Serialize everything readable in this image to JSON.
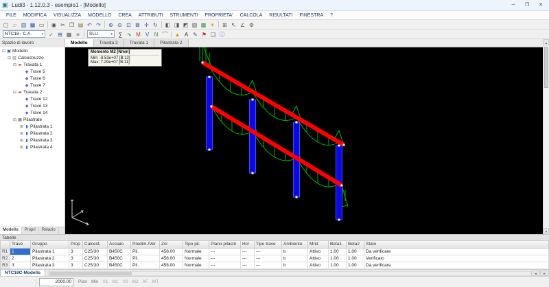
{
  "window": {
    "icon_glyph": "▣",
    "title": "Ludi3 - 1.12.0.3 - esempio1 - [Modello]",
    "minimize": "─",
    "maximize": "❐",
    "close": "✕"
  },
  "menu": {
    "items": [
      "FILE",
      "MODIFICA",
      "VISUALIZZA",
      "MODELLO",
      "CREA",
      "ATTRIBUTI",
      "STRUMENTI",
      "PROPRIETA'",
      "CALCOLA",
      "RISULTATI",
      "FINESTRA",
      "?"
    ]
  },
  "toolbar1": {
    "icons": [
      {
        "name": "new-file",
        "glyph": "▢",
        "style": "color:#444444"
      },
      {
        "name": "open-folder",
        "glyph": "▱",
        "style": "color:#c08a2d"
      },
      {
        "name": "save",
        "glyph": "▥",
        "style": "color:#2a5db0"
      },
      {
        "name": "save-all",
        "glyph": "▦",
        "style": "color:#2a5db0"
      },
      {
        "name": "print",
        "glyph": "▭",
        "style": "color:#444444"
      },
      {
        "name": "snapshot",
        "glyph": "◉",
        "style": "color:#444444"
      },
      {
        "name": "cut",
        "glyph": "✂",
        "style": "color:#444444"
      },
      {
        "name": "copy",
        "glyph": "❐",
        "style": "color:#444444"
      },
      {
        "name": "paste",
        "glyph": "▤",
        "style": "color:#8a6d3b"
      },
      {
        "name": "undo",
        "glyph": "↶",
        "style": "color:#2a5db0"
      },
      {
        "name": "redo",
        "glyph": "↷",
        "style": "color:#2a5db0"
      },
      {
        "name": "zoom-in",
        "glyph": "⊕",
        "style": "color:#2a5db0"
      },
      {
        "name": "zoom-out",
        "glyph": "⊖",
        "style": "color:#2a5db0"
      },
      {
        "name": "zoom-window",
        "glyph": "⊡",
        "style": "color:#2a5db0"
      },
      {
        "name": "zoom-extents",
        "glyph": "⊠",
        "style": "color:#2a5db0"
      },
      {
        "name": "pan",
        "glyph": "✛",
        "style": "color:#2a5db0"
      },
      {
        "name": "orbit",
        "glyph": "↻",
        "style": "color:#2a5db0"
      },
      {
        "name": "view-top",
        "glyph": "◧",
        "style": "color:#555555"
      },
      {
        "name": "view-front",
        "glyph": "◨",
        "style": "color:#555555"
      },
      {
        "name": "view-iso",
        "glyph": "◩",
        "style": "color:#555555"
      },
      {
        "name": "wireframe",
        "glyph": "▧",
        "style": "color:#555555"
      },
      {
        "name": "shaded",
        "glyph": "▩",
        "style": "color:#3e8e41"
      },
      {
        "name": "render",
        "glyph": "☀",
        "style": "color:#d49a00"
      },
      {
        "name": "grid",
        "glyph": "⊞",
        "style": "color:#555555"
      },
      {
        "name": "select-arrow",
        "glyph": "↖",
        "style": "color:#333333"
      },
      {
        "name": "measure",
        "glyph": "∠",
        "style": "color:#555555"
      },
      {
        "name": "options",
        "glyph": "⚙",
        "style": "color:#555555"
      }
    ]
  },
  "toolbar2": {
    "code": "NTC18 - C.A.",
    "slu": "SLU",
    "arrow": "▾",
    "icons_a": [
      {
        "name": "check-model",
        "glyph": "✓",
        "style": "color:#3e8e41"
      },
      {
        "name": "load-combinations",
        "glyph": "⊞",
        "style": "color:#2a5db0"
      },
      {
        "name": "tables",
        "glyph": "▦",
        "style": "color:#555555"
      },
      {
        "name": "properties-list",
        "glyph": "≡",
        "style": "color:#555555"
      }
    ],
    "icons_b": [
      {
        "name": "calculate",
        "glyph": "∑",
        "style": "color:#333333"
      },
      {
        "name": "diagram",
        "glyph": "∿",
        "style": "color:#00a000"
      },
      {
        "name": "moment-m",
        "glyph": "M",
        "style": "color:#c0392b"
      },
      {
        "name": "shear-v",
        "glyph": "V",
        "style": "color:#2a5db0"
      },
      {
        "name": "axial-n",
        "glyph": "N",
        "style": "color:#3e8e41"
      },
      {
        "name": "deformed-shape",
        "glyph": "⌒",
        "style": "color:#8e44ad"
      },
      {
        "name": "envelope",
        "glyph": "▲",
        "style": "color:#d49a00"
      },
      {
        "name": "labels",
        "glyph": "A",
        "style": "color:#333333"
      },
      {
        "name": "edit",
        "glyph": "✎",
        "style": "color:#555555"
      },
      {
        "name": "flag",
        "glyph": "⚑",
        "style": "color:#c0392b"
      },
      {
        "name": "layers",
        "glyph": "❏",
        "style": "color:#555555"
      },
      {
        "name": "info",
        "glyph": "ⓘ",
        "style": "color:#2a5db0"
      }
    ]
  },
  "workspace": {
    "title": "Spazio di lavoro",
    "tabs": [
      "Modello",
      "Propri",
      "Relazio"
    ],
    "tree": [
      {
        "label": "Modello",
        "expander": "⊟",
        "glyph": "▣",
        "iconstyle": "color:#2a5db0"
      },
      {
        "label": "Calcestruzzo",
        "expander": "⊟",
        "glyph": "▧",
        "iconstyle": "color:#777777"
      },
      {
        "label": "Travata 1",
        "expander": "⊟",
        "glyph": "▰",
        "iconstyle": "color:#c0392b"
      },
      {
        "label": "Trave 5",
        "expander": "",
        "glyph": "◆",
        "iconstyle": "color:#6a5acd"
      },
      {
        "label": "Trave 6",
        "expander": "",
        "glyph": "◆",
        "iconstyle": "color:#6a5acd"
      },
      {
        "label": "Trave 7",
        "expander": "",
        "glyph": "◆",
        "iconstyle": "color:#6a5acd"
      },
      {
        "label": "Travata 2",
        "expander": "⊟",
        "glyph": "▰",
        "iconstyle": "color:#c0392b"
      },
      {
        "label": "Trave 12",
        "expander": "",
        "glyph": "◆",
        "iconstyle": "color:#6a5acd"
      },
      {
        "label": "Trave 13",
        "expander": "",
        "glyph": "◆",
        "iconstyle": "color:#6a5acd"
      },
      {
        "label": "Trave 14",
        "expander": "",
        "glyph": "◆",
        "iconstyle": "color:#6a5acd"
      },
      {
        "label": "Pilastrate",
        "expander": "⊟",
        "glyph": "▦",
        "iconstyle": "color:#555555"
      },
      {
        "label": "Pilastrata 1",
        "expander": "⊞",
        "glyph": "▮",
        "iconstyle": "color:#2a6fd4"
      },
      {
        "label": "Pilastrata 2",
        "expander": "⊞",
        "glyph": "▮",
        "iconstyle": "color:#2a6fd4"
      },
      {
        "label": "Pilastrata 3",
        "expander": "⊞",
        "glyph": "▮",
        "iconstyle": "color:#2a6fd4"
      },
      {
        "label": "Pilastrata 4",
        "expander": "⊞",
        "glyph": "▮",
        "iconstyle": "color:#2a6fd4"
      }
    ]
  },
  "view": {
    "tabs": [
      "Modello",
      "Travata 2",
      "Travata 1",
      "Pilastrata 2"
    ],
    "tooltip": {
      "title": "Momento M2 [Nmm]",
      "min": "Min:   -8.53e+07 [B:12]",
      "max": "Max:   7.29e+07 [B:11]"
    }
  },
  "colors": {
    "beam": "#ff0000",
    "column": "#0a0ae0",
    "diagram": "#00b400",
    "canvas_bg": "#000000"
  },
  "table": {
    "title": "Tabelle",
    "row_headers": [
      "R1",
      "R2",
      "R3"
    ],
    "headers": [
      "Trave",
      "Gruppo",
      "Prop",
      "Calcest.",
      "Acciaio",
      "Predim./Ver",
      "Zcr",
      "Tipo pil.",
      "Piano pilastri",
      "Hcr",
      "Tipo trave",
      "Ambiente",
      "Mrid",
      "Beta1",
      "Beta2",
      "Stato"
    ],
    "rows": [
      [
        "1",
        "Pilastrata 1",
        "3",
        "C25/30",
        "B450C",
        "Pil.",
        "458.00",
        "Normale",
        "---",
        "---",
        "---",
        "b",
        "Attivo",
        "1.00",
        "1.00",
        "Da verificare"
      ],
      [
        "2",
        "Pilastrata 2",
        "3",
        "C25/30",
        "B450C",
        "Pil.",
        "458.00",
        "Normale",
        "---",
        "---",
        "---",
        "b",
        "Attivo",
        "1.00",
        "1.00",
        "Verificato"
      ],
      [
        "3",
        "Pilastrata 3",
        "3",
        "C25/30",
        "B450C",
        "Pil.",
        "458.00",
        "Normale",
        "---",
        "---",
        "---",
        "b",
        "Attivo",
        "1.00",
        "1.00",
        "Da verificare"
      ]
    ]
  },
  "bottom_tab": "NTC18C-Modello",
  "status": {
    "field": "2000.00",
    "items": [
      "Pian",
      "Min",
      "V1",
      "M1",
      "V2",
      "M2",
      "AF",
      "MT"
    ]
  }
}
